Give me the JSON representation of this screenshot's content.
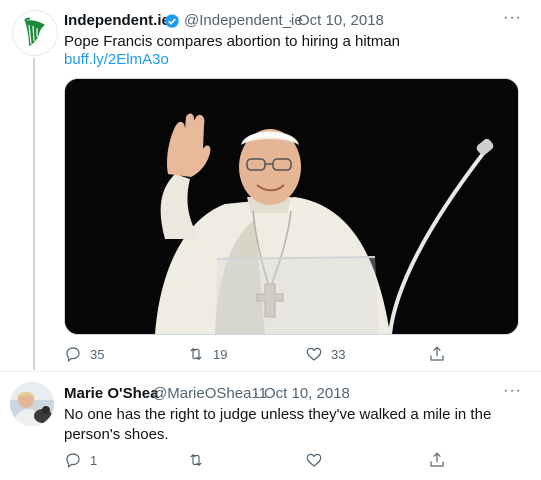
{
  "tweet1": {
    "display_name": "Independent.ie",
    "handle": "@Independent_ie",
    "separator": "·",
    "date": "Oct 10, 2018",
    "text": "Pope Francis compares abortion to hiring a hitman",
    "link": "buff.ly/2ElmA3o",
    "replies": "35",
    "retweets": "19",
    "likes": "33"
  },
  "tweet2": {
    "display_name": "Marie O'Shea",
    "handle": "@MarieOShea11",
    "separator": "·",
    "date": "Oct 10, 2018",
    "text": "No one has the right to judge unless they've walked a mile in the person's shoes.",
    "replies": "1"
  },
  "more_label": "···",
  "colors": {
    "accent": "#1d9bf0",
    "muted": "#536471",
    "harp_green": "#1a8a3a"
  }
}
